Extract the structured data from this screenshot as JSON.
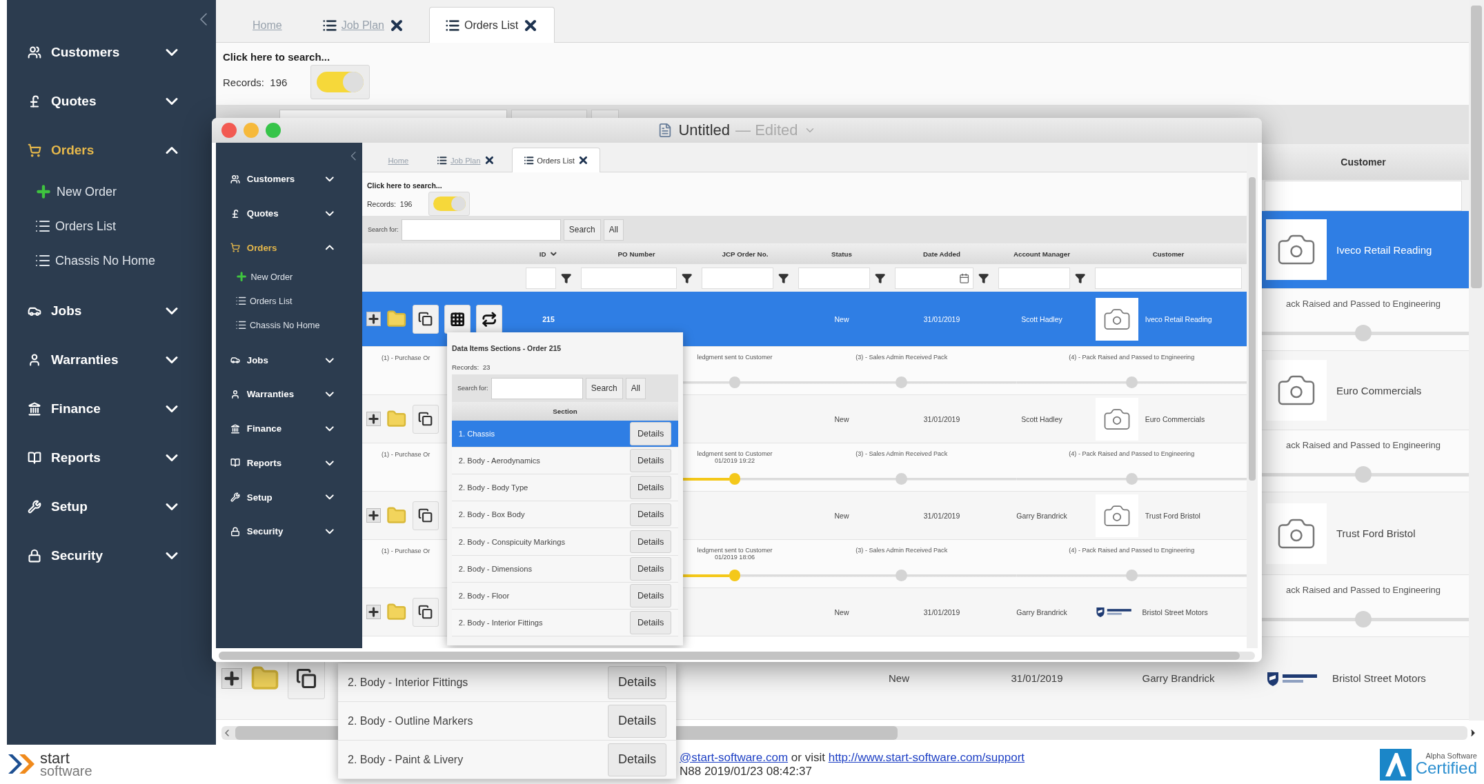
{
  "background_app": {
    "sidebar": {
      "items": [
        {
          "label": "Customers",
          "expanded": false
        },
        {
          "label": "Quotes",
          "expanded": false
        },
        {
          "label": "Orders",
          "expanded": true,
          "children": [
            {
              "label": "New Order"
            },
            {
              "label": "Orders List"
            },
            {
              "label": "Chassis No Home"
            }
          ]
        },
        {
          "label": "Jobs",
          "expanded": false
        },
        {
          "label": "Warranties",
          "expanded": false
        },
        {
          "label": "Finance",
          "expanded": false
        },
        {
          "label": "Reports",
          "expanded": false
        },
        {
          "label": "Setup",
          "expanded": false
        },
        {
          "label": "Security",
          "expanded": false
        }
      ]
    },
    "tabs": [
      {
        "label": "Home",
        "closable": false,
        "selected": false
      },
      {
        "label": "Job Plan",
        "closable": true,
        "selected": false
      },
      {
        "label": "Orders List",
        "closable": true,
        "selected": true
      }
    ],
    "search_prompt": "Click here to search...",
    "records": "Records:  196",
    "toggle": {
      "on": true
    },
    "table": {
      "columns": [
        {
          "label": "Customer"
        }
      ],
      "rows": [
        {
          "kind": "order",
          "selected": true,
          "customer": "Iveco Retail Reading"
        },
        {
          "kind": "progress",
          "stages": [
            {
              "label": "ack Raised and Passed to Engineering",
              "reached": false
            }
          ]
        },
        {
          "kind": "order",
          "selected": false,
          "customer": "Euro Commercials"
        },
        {
          "kind": "progress",
          "stages": [
            {
              "label": "ack Raised and Passed to Engineering",
              "reached": false
            }
          ]
        },
        {
          "kind": "order",
          "selected": false,
          "customer": "Trust Ford Bristol"
        },
        {
          "kind": "progress",
          "stages": [
            {
              "label": "ack Raised and Passed to Engineering",
              "reached": false
            }
          ]
        },
        {
          "kind": "logo_order",
          "selected": false,
          "actions": true,
          "status": "New",
          "date": "31/01/2019",
          "manager": "Garry Brandrick",
          "customer": "Bristol Street Motors"
        }
      ]
    },
    "sections_popup": {
      "items": [
        {
          "label": "2. Body - Interior Fittings",
          "button": "Details",
          "selected": false
        },
        {
          "label": "2. Body - Outline Markers",
          "button": "Details",
          "selected": false
        },
        {
          "label": "2. Body - Paint & Livery",
          "button": "Details",
          "selected": false
        }
      ]
    }
  },
  "window": {
    "title": "Untitled",
    "status": "— Edited"
  },
  "window_app": {
    "sidebar": {
      "items": [
        {
          "label": "Customers",
          "expanded": false
        },
        {
          "label": "Quotes",
          "expanded": false
        },
        {
          "label": "Orders",
          "expanded": true,
          "children": [
            {
              "label": "New Order"
            },
            {
              "label": "Orders List"
            },
            {
              "label": "Chassis No Home"
            }
          ]
        },
        {
          "label": "Jobs",
          "expanded": false
        },
        {
          "label": "Warranties",
          "expanded": false
        },
        {
          "label": "Finance",
          "expanded": false
        },
        {
          "label": "Reports",
          "expanded": false
        },
        {
          "label": "Setup",
          "expanded": false
        },
        {
          "label": "Security",
          "expanded": false
        }
      ]
    },
    "tabs": [
      {
        "label": "Home",
        "closable": false,
        "selected": false
      },
      {
        "label": "Job Plan",
        "closable": true,
        "selected": false
      },
      {
        "label": "Orders List",
        "closable": true,
        "selected": true
      }
    ],
    "search_prompt": "Click here to search...",
    "records": "Records:  196",
    "toggle": {
      "on": true
    },
    "search": {
      "label": "Search for:",
      "buttons": [
        "Search",
        "All"
      ]
    },
    "table": {
      "columns": [
        {
          "label": "ID",
          "sorted": true,
          "date_picker": false,
          "funnel": true
        },
        {
          "label": "PO Number",
          "sorted": false,
          "date_picker": false,
          "funnel": true
        },
        {
          "label": "JCP Order No.",
          "sorted": false,
          "date_picker": false,
          "funnel": true
        },
        {
          "label": "Status",
          "sorted": false,
          "date_picker": false,
          "funnel": true
        },
        {
          "label": "Date Added",
          "sorted": false,
          "date_picker": true,
          "funnel": true
        },
        {
          "label": "Account Manager",
          "sorted": false,
          "date_picker": false,
          "funnel": true
        },
        {
          "label": "Customer",
          "sorted": false,
          "date_picker": false,
          "funnel": false
        }
      ],
      "rows": [
        {
          "kind": "order",
          "selected": true,
          "actions": true,
          "id": "215",
          "status": "New",
          "date": "31/01/2019",
          "manager": "Scott Hadley",
          "customer": "Iveco Retail Reading"
        },
        {
          "kind": "progress",
          "first_stage": "(1) - Purchase Or",
          "stages": [
            {
              "label": "ledgment sent to Customer",
              "reached": false
            },
            {
              "label": "(3) - Sales Admin Received Pack",
              "reached": false
            },
            {
              "label": "(4) - Pack Raised and Passed to Engineering",
              "reached": false
            }
          ]
        },
        {
          "kind": "order",
          "selected": false,
          "actions": true,
          "status": "New",
          "date": "31/01/2019",
          "manager": "Scott Hadley",
          "customer": "Euro Commercials"
        },
        {
          "kind": "progress",
          "first_stage": "(1) - Purchase Or",
          "stages": [
            {
              "label": "ledgment sent to Customer",
              "time": "01/2019 19:22",
              "reached": true
            },
            {
              "label": "(3) - Sales Admin Received Pack",
              "reached": false
            },
            {
              "label": "(4) - Pack Raised and Passed to Engineering",
              "reached": false
            }
          ]
        },
        {
          "kind": "order",
          "selected": false,
          "actions": true,
          "status": "New",
          "date": "31/01/2019",
          "manager": "Garry Brandrick",
          "customer": "Trust Ford Bristol"
        },
        {
          "kind": "progress",
          "first_stage": "(1) - Purchase Or",
          "stages": [
            {
              "label": "ledgment sent to Customer",
              "time": "01/2019 18:06",
              "reached": true
            },
            {
              "label": "(3) - Sales Admin Received Pack",
              "reached": false
            },
            {
              "label": "(4) - Pack Raised and Passed to Engineering",
              "reached": false
            }
          ]
        },
        {
          "kind": "logo_order",
          "selected": false,
          "actions": true,
          "status": "New",
          "date": "31/01/2019",
          "manager": "Garry Brandrick",
          "customer": "Bristol Street Motors"
        }
      ]
    },
    "sections_popup": {
      "title": "Data Items Sections - Order 215",
      "records": "Records:  23",
      "search_label": "Search for:",
      "buttons": [
        "Search",
        "All"
      ],
      "column": "Section",
      "items": [
        {
          "label": "1. Chassis",
          "button": "Details",
          "selected": true
        },
        {
          "label": "2. Body - Aerodynamics",
          "button": "Details",
          "selected": false
        },
        {
          "label": "2. Body - Body Type",
          "button": "Details",
          "selected": false
        },
        {
          "label": "2. Body - Box Body",
          "button": "Details",
          "selected": false
        },
        {
          "label": "2. Body - Conspicuity Markings",
          "button": "Details",
          "selected": false
        },
        {
          "label": "2. Body - Dimensions",
          "button": "Details",
          "selected": false
        },
        {
          "label": "2. Body - Floor",
          "button": "Details",
          "selected": false
        },
        {
          "label": "2. Body - Interior Fittings",
          "button": "Details",
          "selected": false
        }
      ]
    }
  },
  "footer": {
    "brand": {
      "name": "start",
      "tagline": "software"
    },
    "support": {
      "email": "@start-software.com",
      "joiner": "or visit",
      "url": "http://www.start-software.com/support"
    },
    "build": "N88 2019/01/23 08:42:37",
    "badge": {
      "line1": "Alpha Software",
      "line2": "Certified"
    }
  }
}
